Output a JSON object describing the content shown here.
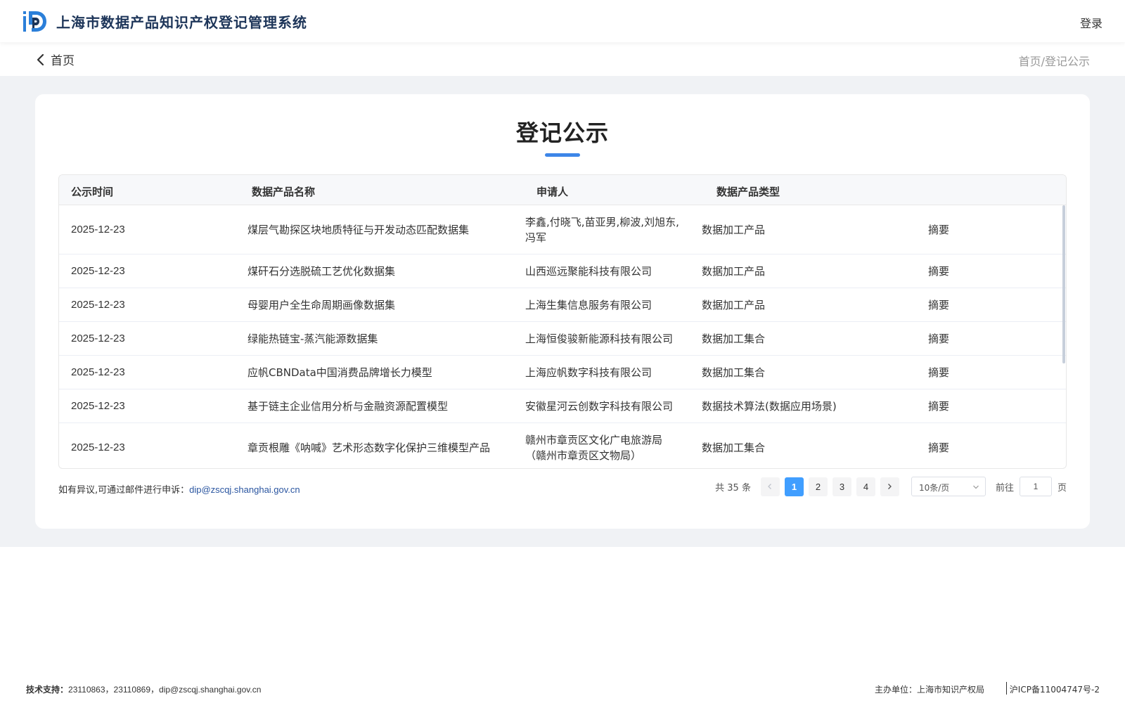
{
  "header": {
    "site_title": "上海市数据产品知识产权登记管理系统",
    "login_label": "登录",
    "logo_icon": "ipd-logo-icon",
    "brand_color": "#2b7fd9"
  },
  "subheader": {
    "back_label": "首页",
    "breadcrumb": [
      "首页",
      "/",
      "登记公示"
    ]
  },
  "main": {
    "title": "登记公示",
    "accent_color": "#3d86e8",
    "table": {
      "columns": [
        "公示时间",
        "数据产品名称",
        "申请人",
        "数据产品类型"
      ],
      "rows": [
        {
          "date": "2025-12-23",
          "name": "煤层气勘探区块地质特征与开发动态匹配数据集",
          "applicant": "李鑫,付晓飞,苗亚男,柳波,刘旭东,冯军",
          "applicant_lines": [
            "李鑫,付晓飞,苗亚男,柳波,刘旭东,",
            "冯军"
          ],
          "type": "数据加工产品",
          "action": "摘要"
        },
        {
          "date": "2025-12-23",
          "name": "煤矸石分选脱硫工艺优化数据集",
          "applicant": "山西巡远聚能科技有限公司",
          "applicant_lines": [
            "山西巡远聚能科技有限公司"
          ],
          "type": "数据加工产品",
          "action": "摘要"
        },
        {
          "date": "2025-12-23",
          "name": "母婴用户全生命周期画像数据集",
          "applicant": "上海生集信息服务有限公司",
          "applicant_lines": [
            "上海生集信息服务有限公司"
          ],
          "type": "数据加工产品",
          "action": "摘要"
        },
        {
          "date": "2025-12-23",
          "name": "绿能热链宝-蒸汽能源数据集",
          "applicant": "上海恒俊骏新能源科技有限公司",
          "applicant_lines": [
            "上海恒俊骏新能源科技有限公司"
          ],
          "type": "数据加工集合",
          "action": "摘要"
        },
        {
          "date": "2025-12-23",
          "name": "应帆CBNData中国消费品牌增长力模型",
          "applicant": "上海应帆数字科技有限公司",
          "applicant_lines": [
            "上海应帆数字科技有限公司"
          ],
          "type": "数据加工集合",
          "action": "摘要"
        },
        {
          "date": "2025-12-23",
          "name": "基于链主企业信用分析与金融资源配置模型",
          "applicant": "安徽星河云创数字科技有限公司",
          "applicant_lines": [
            "安徽星河云创数字科技有限公司"
          ],
          "type": "数据技术算法(数据应用场景)",
          "action": "摘要"
        },
        {
          "date": "2025-12-23",
          "name": "章贡根雕《呐喊》艺术形态数字化保护三维模型产品",
          "applicant": "赣州市章贡区文化广电旅游局（赣州市章贡区文物局）",
          "applicant_lines": [
            "赣州市章贡区文化广电旅游局",
            "（赣州市章贡区文物局）"
          ],
          "type": "数据加工集合",
          "action": "摘要"
        }
      ]
    },
    "notice_prefix": "如有异议,可通过邮件进行申诉：",
    "notice_email": "dip@zscqj.shanghai.gov.cn",
    "pagination": {
      "total_label": "共 35 条",
      "pages": [
        "1",
        "2",
        "3",
        "4"
      ],
      "current_page": "1",
      "page_size_label": "10条/页",
      "goto_label": "前往",
      "goto_value": "1",
      "page_suffix": "页",
      "active_color": "#409eff"
    }
  },
  "footer": {
    "support_label": "技术支持：",
    "support_value": "23110863，23110869，dip@zscqj.shanghai.gov.cn",
    "host": "主办单位：上海市知识产权局",
    "icp": "沪ICP备11004747号-2"
  }
}
